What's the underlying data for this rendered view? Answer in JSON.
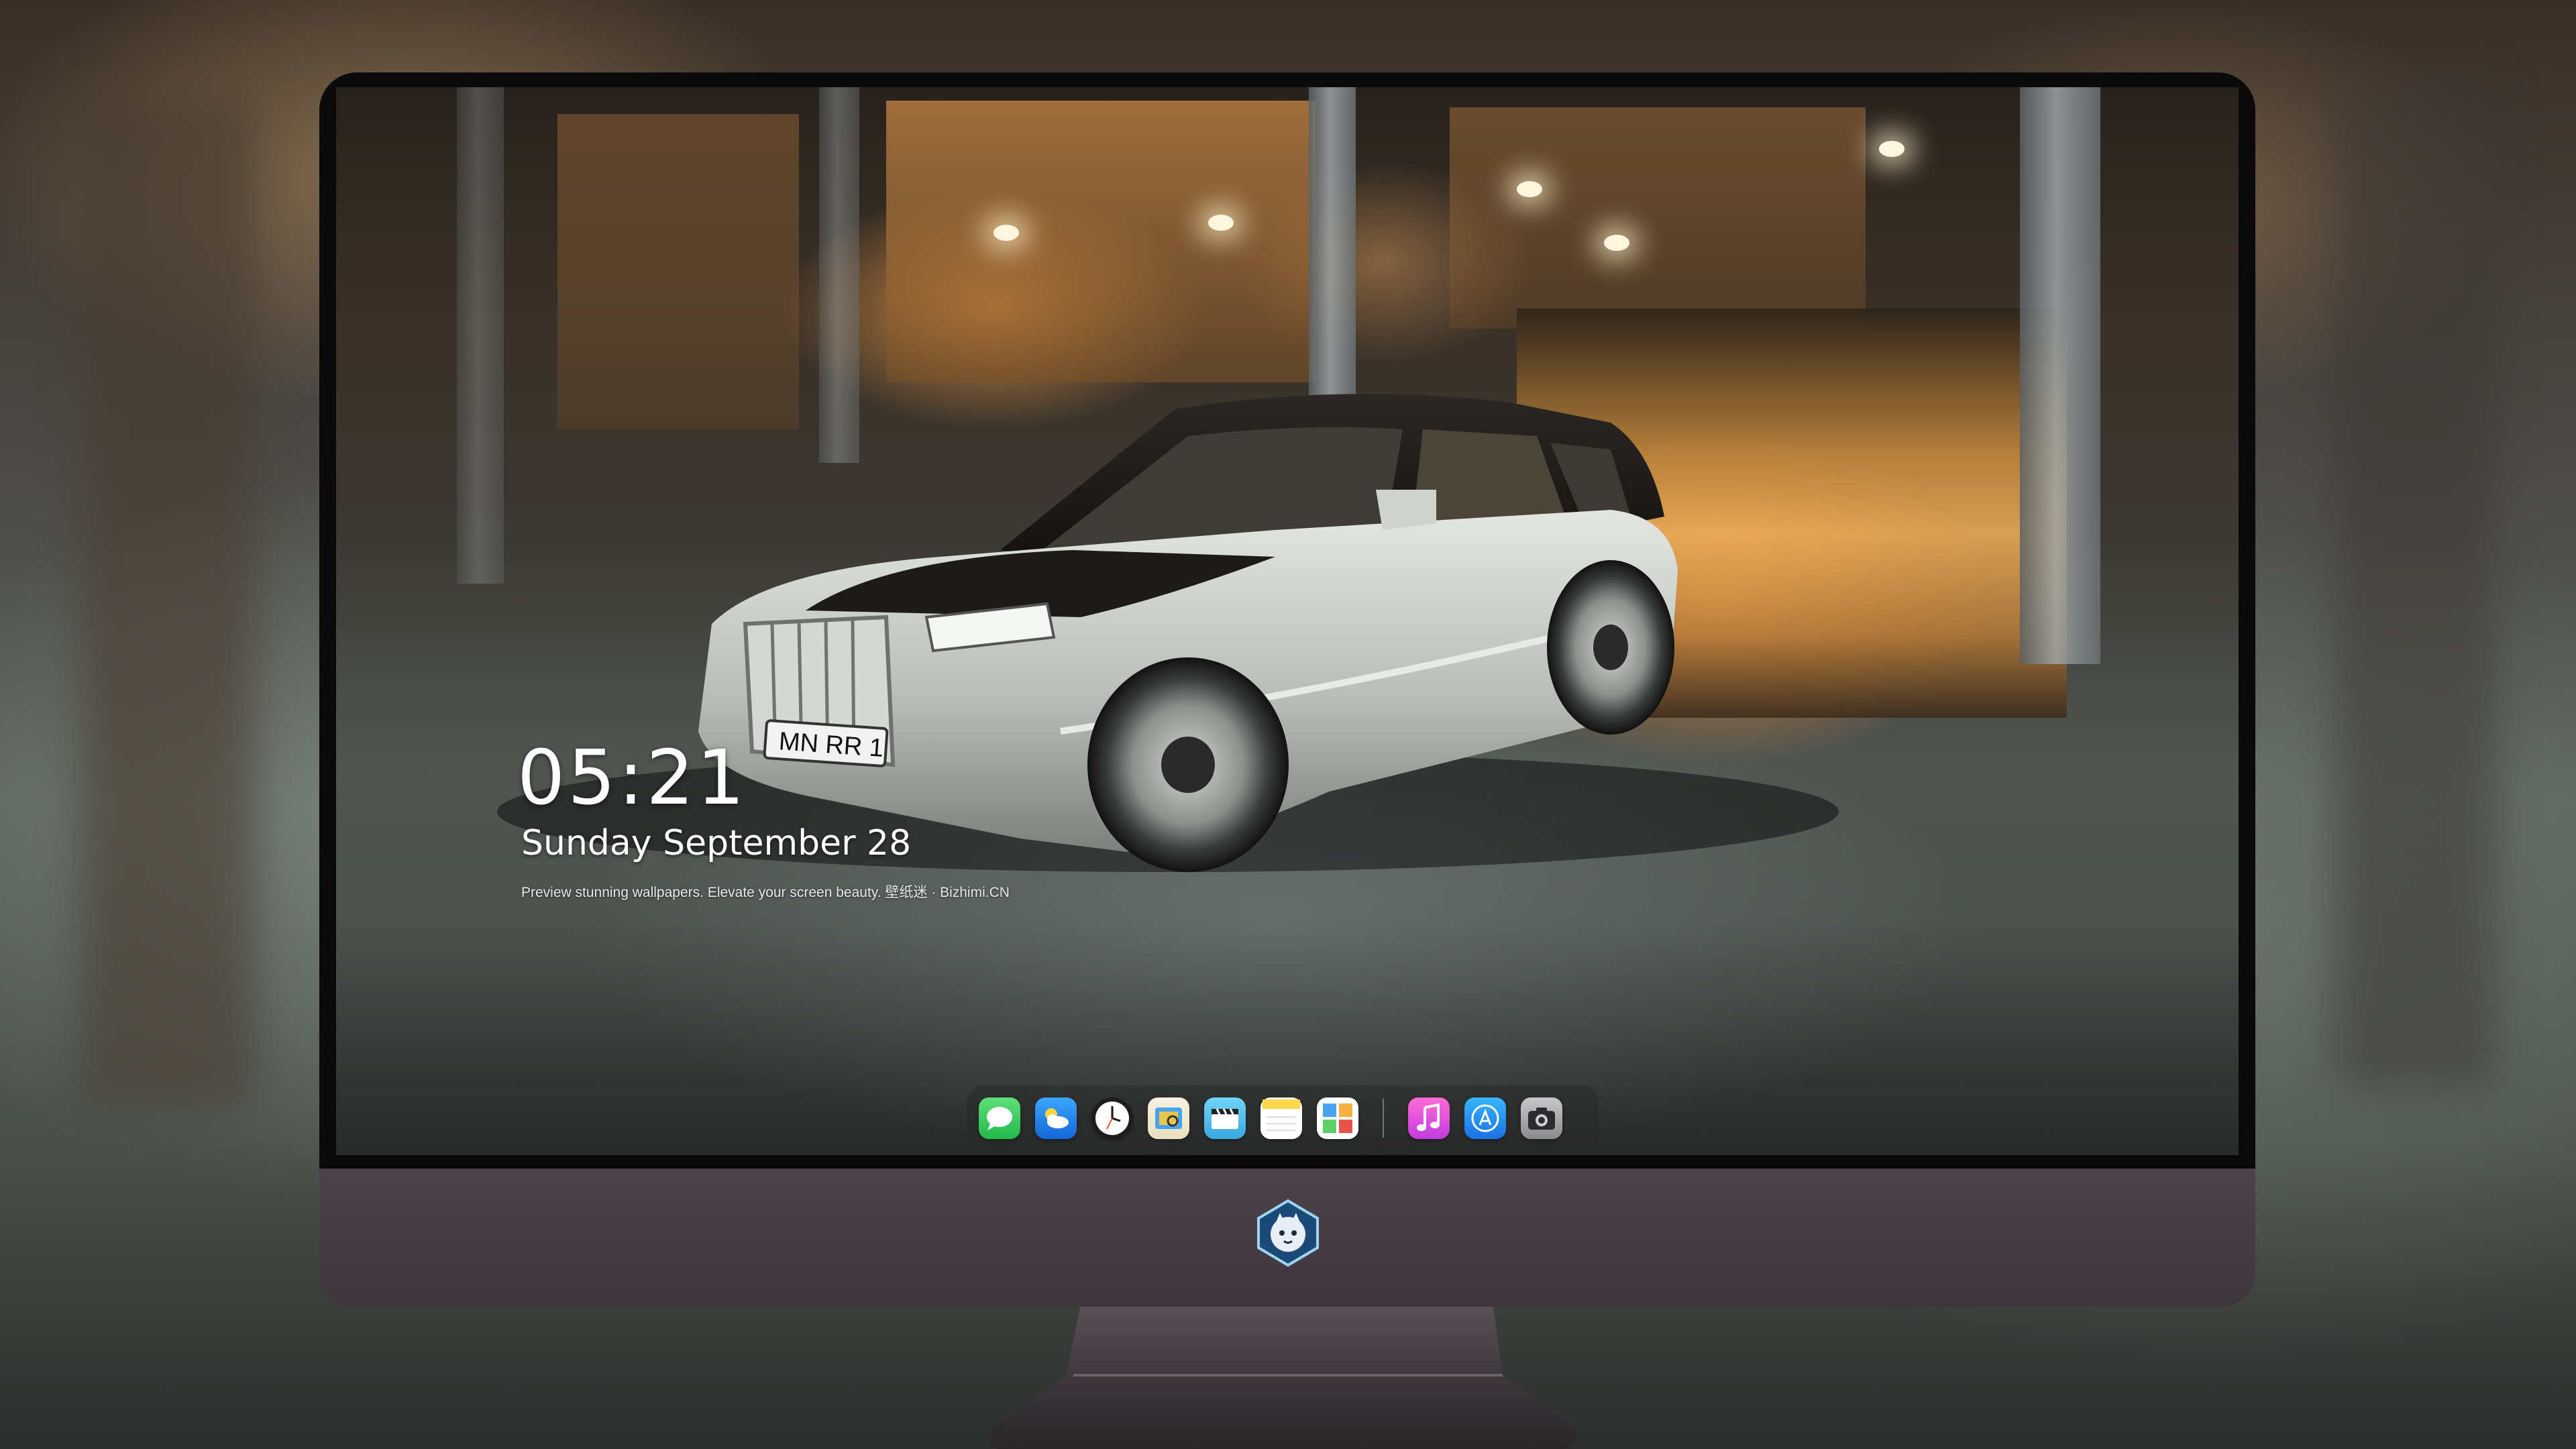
{
  "lock_screen": {
    "time": "05:21",
    "date": "Sunday September  28",
    "tagline": "Preview stunning wallpapers. Elevate your screen beauty. 壁纸迷 · Bizhimi.CN"
  },
  "wallpaper": {
    "car_plate": "MN RR 1"
  },
  "dock": {
    "apps": [
      {
        "icon": "messages-icon",
        "color": "#2fd158"
      },
      {
        "icon": "weather-icon",
        "color": "#1e8ff0"
      },
      {
        "icon": "clock-icon",
        "color": "#ffffff"
      },
      {
        "icon": "preview-icon",
        "color": "#f0c640"
      },
      {
        "icon": "clips-icon",
        "color": "#58c8f0"
      },
      {
        "icon": "notes-icon",
        "color": "#ffd84a"
      },
      {
        "icon": "photos-grid-icon",
        "color": "#ffffff"
      }
    ],
    "pinned": [
      {
        "icon": "music-icon",
        "color": "#f04fd0"
      },
      {
        "icon": "app-store-icon",
        "color": "#1c8ef5"
      },
      {
        "icon": "camera-icon",
        "color": "#8a8a8e"
      }
    ]
  },
  "colors": {
    "bezel": "#0a0a0b",
    "chin": "#433c42",
    "stand": "#3b3538"
  }
}
